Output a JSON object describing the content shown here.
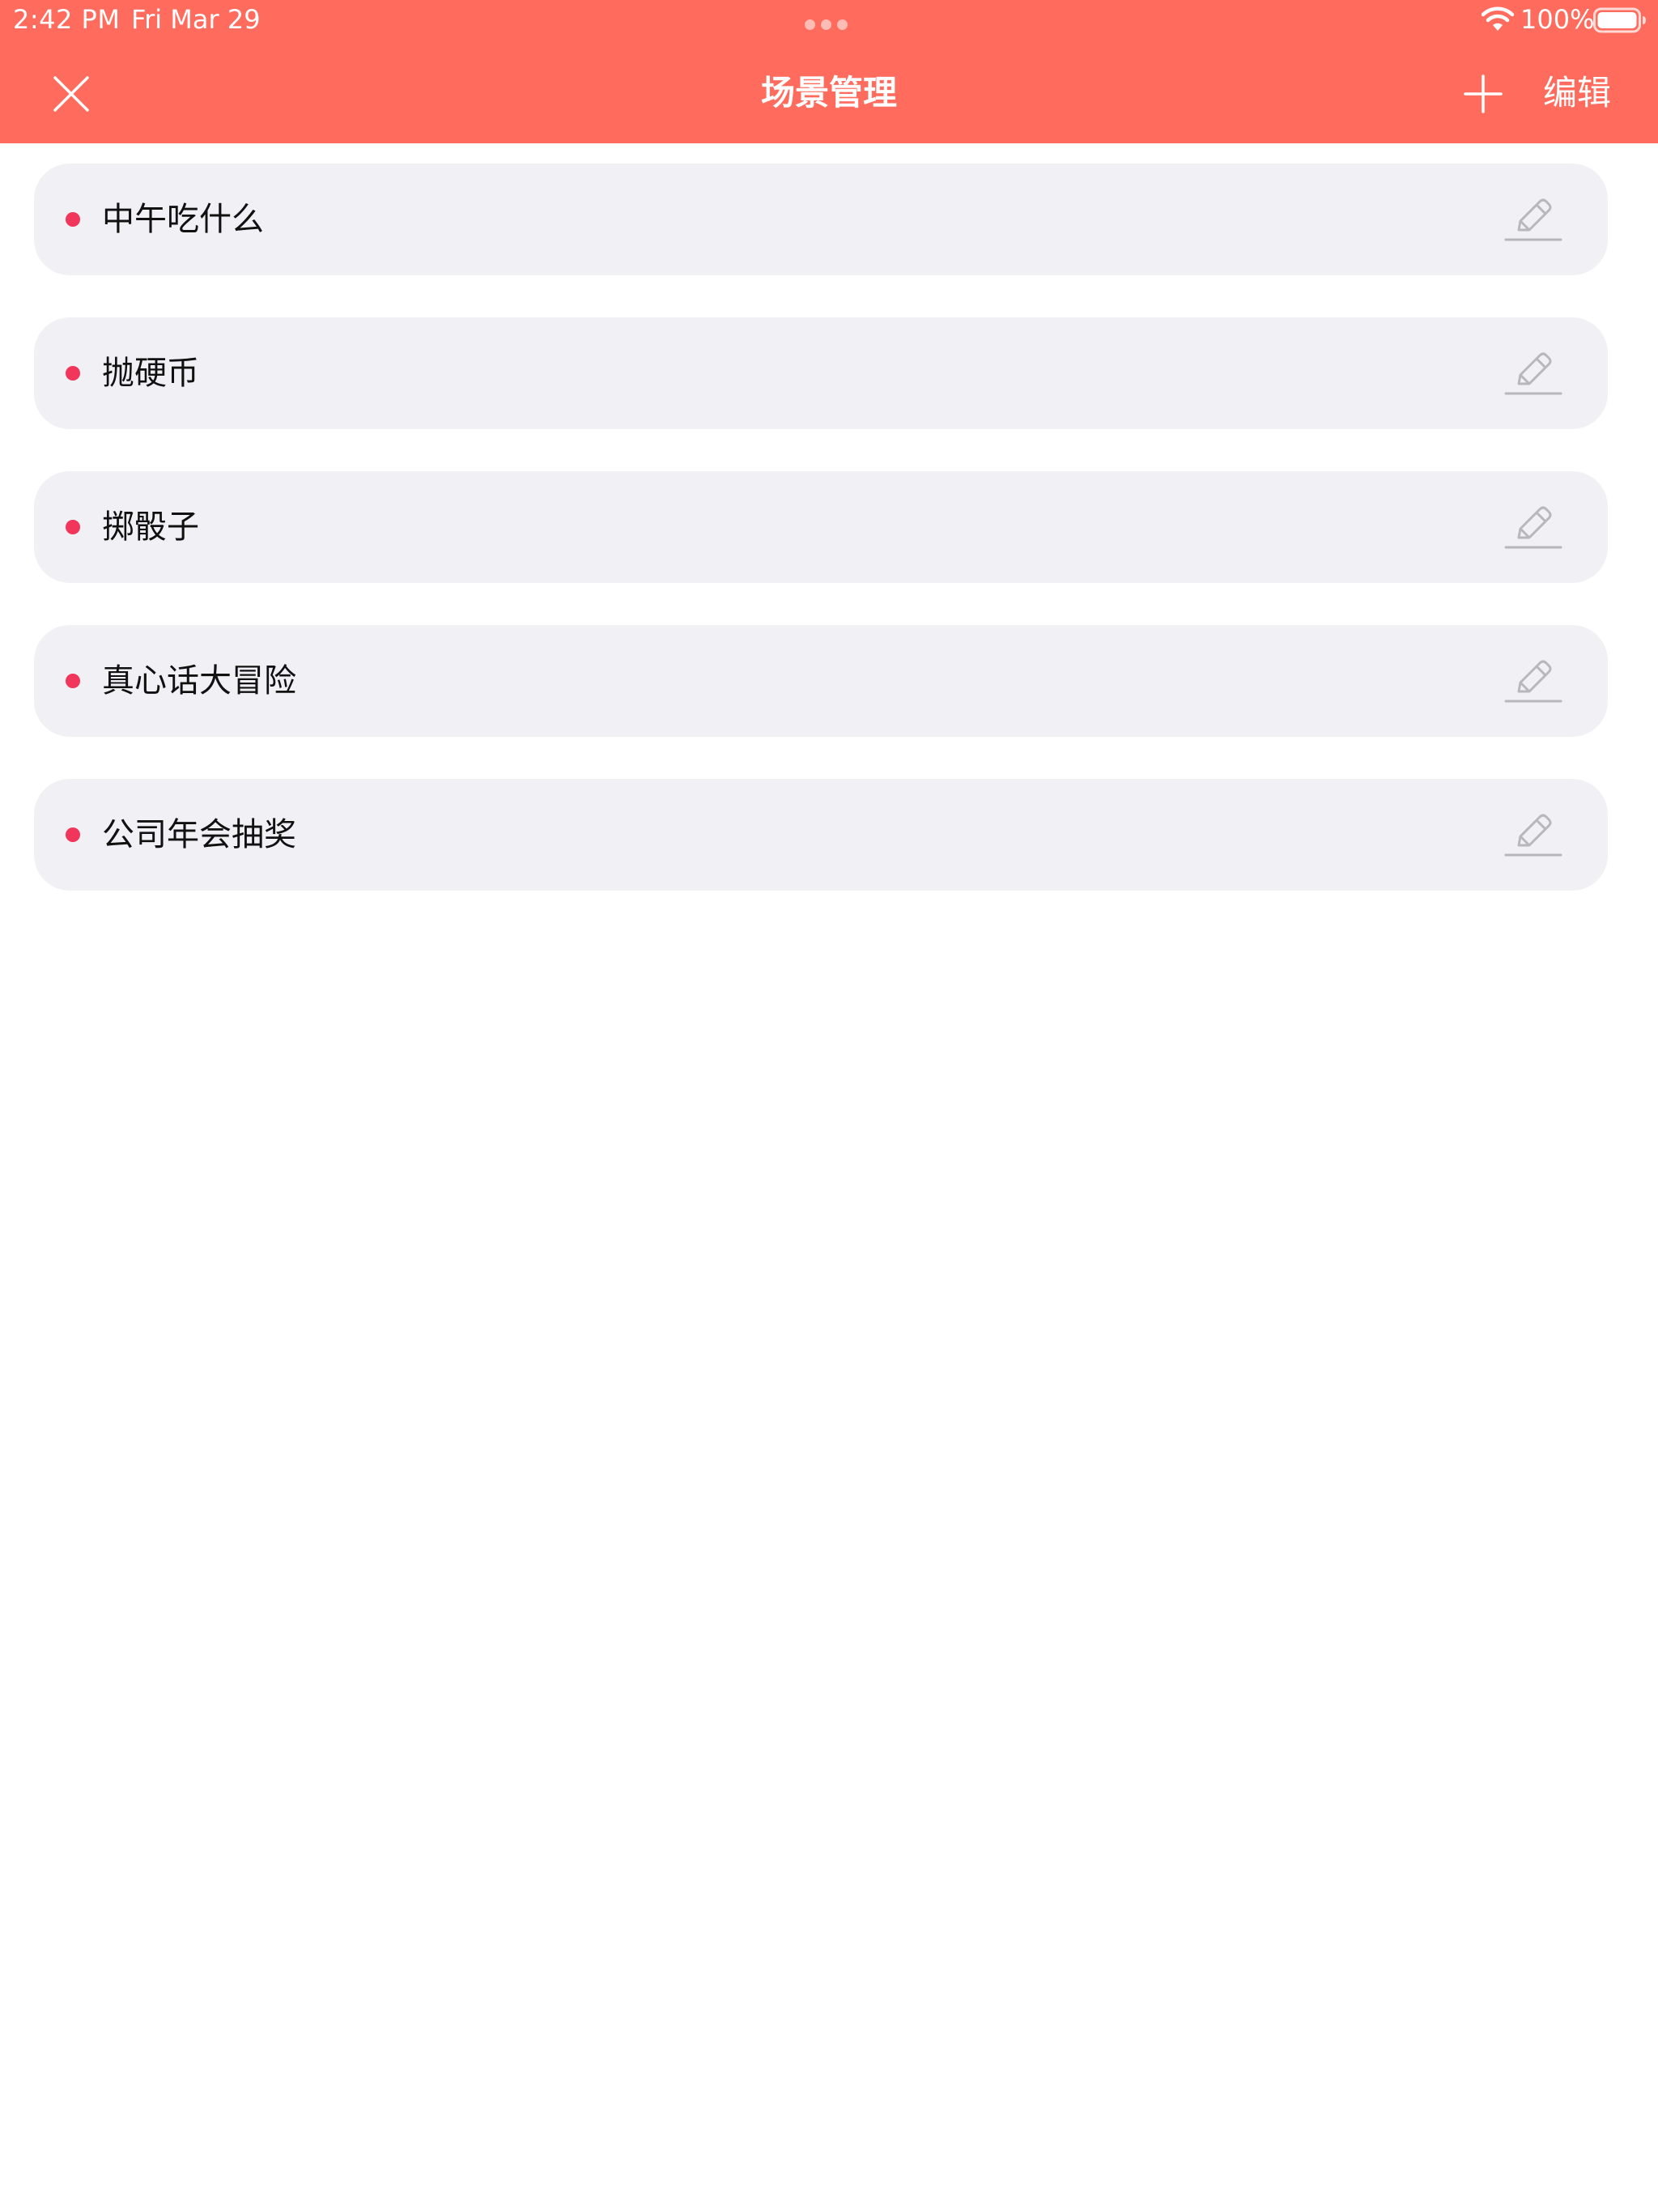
{
  "status_bar": {
    "time": "2:42 PM",
    "date": "Fri Mar 29",
    "battery": "100%"
  },
  "nav": {
    "title": "场景管理",
    "edit_label": "编辑",
    "close_icon": "close-icon",
    "add_icon": "plus-icon"
  },
  "scenes": [
    {
      "label": "中午吃什么"
    },
    {
      "label": "抛硬币"
    },
    {
      "label": "掷骰子"
    },
    {
      "label": "真心话大冒险"
    },
    {
      "label": "公司年会抽奖"
    }
  ],
  "colors": {
    "header": "#ff6b5c",
    "card_background": "#f1f1f5",
    "bullet": "#f2355b",
    "pencil": "#b8b8bc"
  }
}
